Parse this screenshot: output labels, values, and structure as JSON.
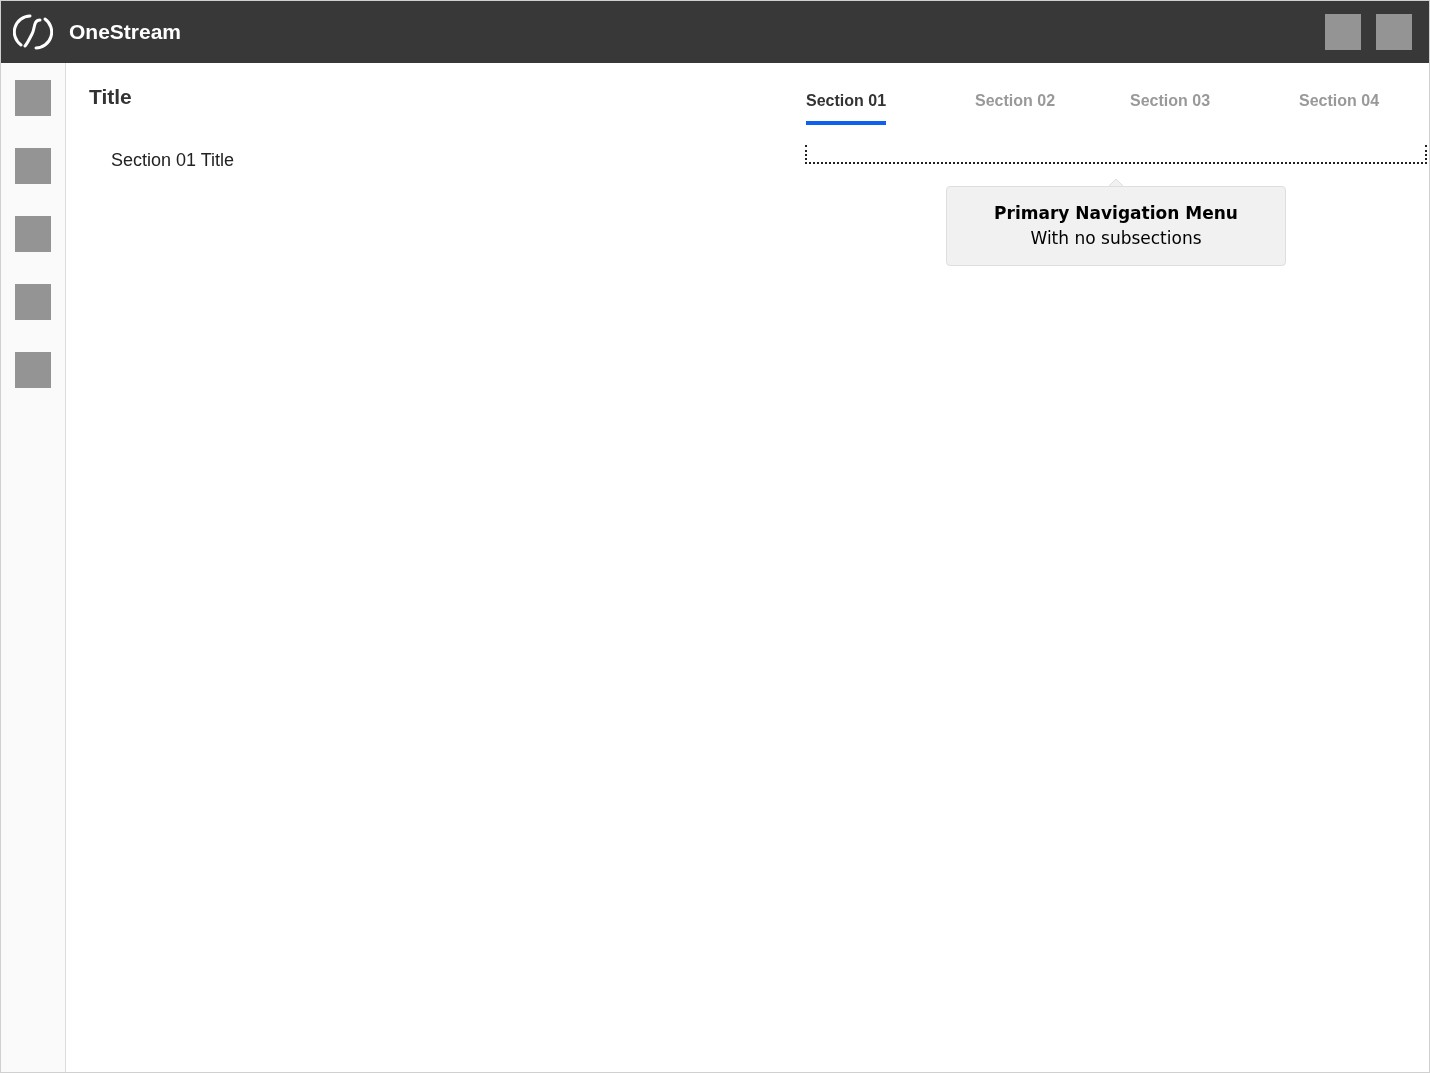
{
  "app": {
    "name": "OneStream"
  },
  "page": {
    "title": "Title",
    "section_title": "Section 01 Title"
  },
  "tabs": [
    {
      "label": "Section 01",
      "selected": true
    },
    {
      "label": "Section 02",
      "selected": false
    },
    {
      "label": "Section 03",
      "selected": false
    },
    {
      "label": "Section 04",
      "selected": false
    }
  ],
  "annotation": {
    "title": "Primary Navigation Menu",
    "subtitle": "With no subsections"
  }
}
